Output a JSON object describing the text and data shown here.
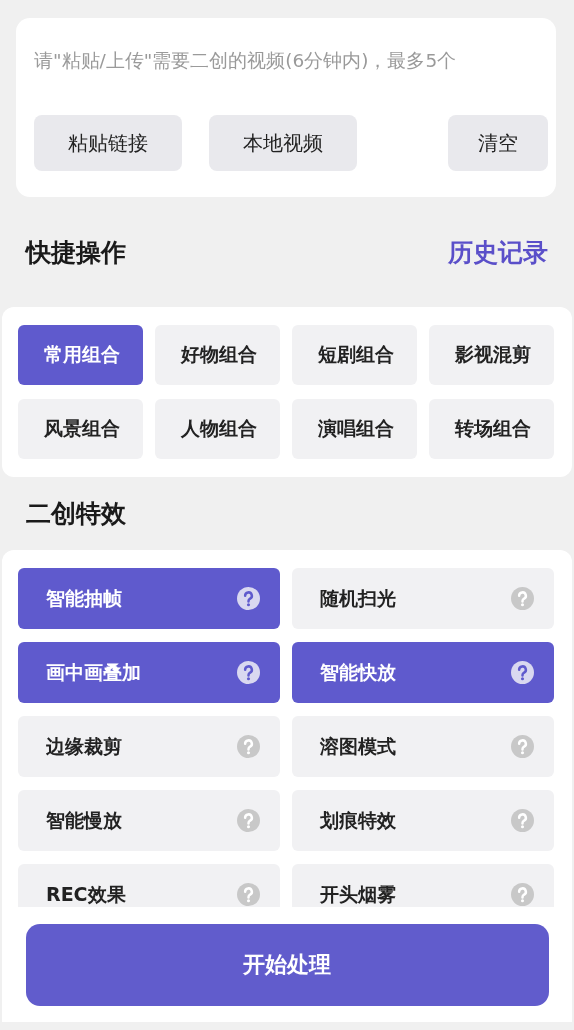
{
  "upload": {
    "placeholder": "请\"粘贴/上传\"需要二创的视频(6分钟内)，最多5个",
    "buttons": [
      "粘贴链接",
      "本地视频",
      "清空"
    ]
  },
  "quick": {
    "title": "快捷操作",
    "history_link": "历史记录",
    "combos": [
      {
        "label": "常用组合",
        "selected": true
      },
      {
        "label": "好物组合",
        "selected": false
      },
      {
        "label": "短剧组合",
        "selected": false
      },
      {
        "label": "影视混剪",
        "selected": false
      },
      {
        "label": "风景组合",
        "selected": false
      },
      {
        "label": "人物组合",
        "selected": false
      },
      {
        "label": "演唱组合",
        "selected": false
      },
      {
        "label": "转场组合",
        "selected": false
      }
    ]
  },
  "effects": {
    "title": "二创特效",
    "items": [
      {
        "label": "智能抽帧",
        "selected": true
      },
      {
        "label": "随机扫光",
        "selected": false
      },
      {
        "label": "画中画叠加",
        "selected": true
      },
      {
        "label": "智能快放",
        "selected": true
      },
      {
        "label": "边缘裁剪",
        "selected": false
      },
      {
        "label": "溶图模式",
        "selected": false
      },
      {
        "label": "智能慢放",
        "selected": false
      },
      {
        "label": "划痕特效",
        "selected": false
      },
      {
        "label": "REC效果",
        "selected": false
      },
      {
        "label": "开头烟雾",
        "selected": false
      }
    ]
  },
  "start_button": "开始处理"
}
